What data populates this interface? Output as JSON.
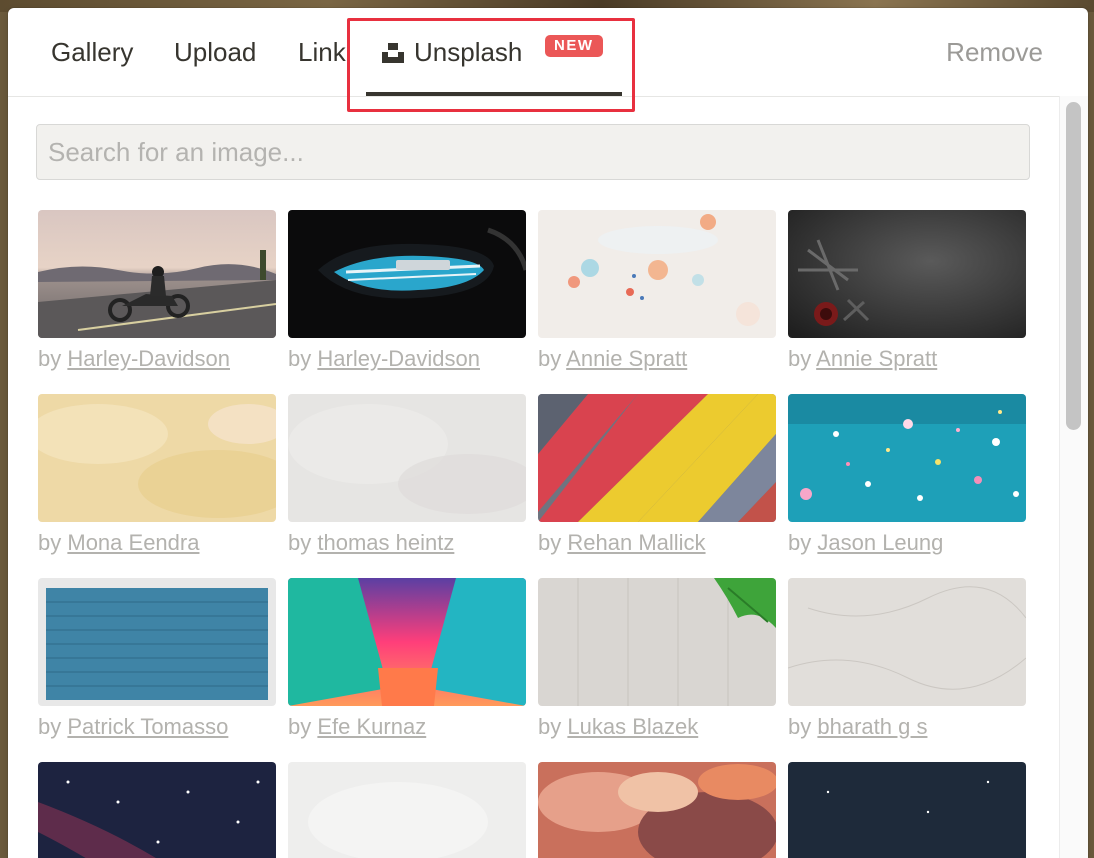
{
  "tabs": {
    "gallery": "Gallery",
    "upload": "Upload",
    "link": "Link",
    "unsplash": "Unsplash",
    "new_badge": "NEW",
    "remove": "Remove",
    "active": "Unsplash"
  },
  "search": {
    "placeholder": "Search for an image...",
    "value": ""
  },
  "credit_prefix": "by",
  "images": [
    {
      "author": "Harley-Davidson",
      "subject": "motorcycle rider on road at dusk"
    },
    {
      "author": "Harley-Davidson",
      "subject": "blue motorcycle fuel tank"
    },
    {
      "author": "Annie Spratt",
      "subject": "watercolor splashes on white"
    },
    {
      "author": "Annie Spratt",
      "subject": "dark texture with flower"
    },
    {
      "author": "Mona Eendra",
      "subject": "yellow painted texture"
    },
    {
      "author": "thomas heintz",
      "subject": "white plaster texture"
    },
    {
      "author": "Rehan Mallick",
      "subject": "colorful wooden stripes"
    },
    {
      "author": "Jason Leung",
      "subject": "confetti on teal"
    },
    {
      "author": "Patrick Tomasso",
      "subject": "blue brick wall"
    },
    {
      "author": "Efe Kurnaz",
      "subject": "neon lit corridor"
    },
    {
      "author": "Lukas Blazek",
      "subject": "wood with green leaves"
    },
    {
      "author": "bharath g s",
      "subject": "marble texture"
    },
    {
      "author": "",
      "subject": "starry night sky"
    },
    {
      "author": "",
      "subject": "white texture"
    },
    {
      "author": "",
      "subject": "red clouds"
    },
    {
      "author": "",
      "subject": "dark navy sky"
    }
  ],
  "colors": {
    "text": "#37352f",
    "muted": "#9b9a97",
    "badge": "#eb5757",
    "highlight": "#e8303f"
  }
}
